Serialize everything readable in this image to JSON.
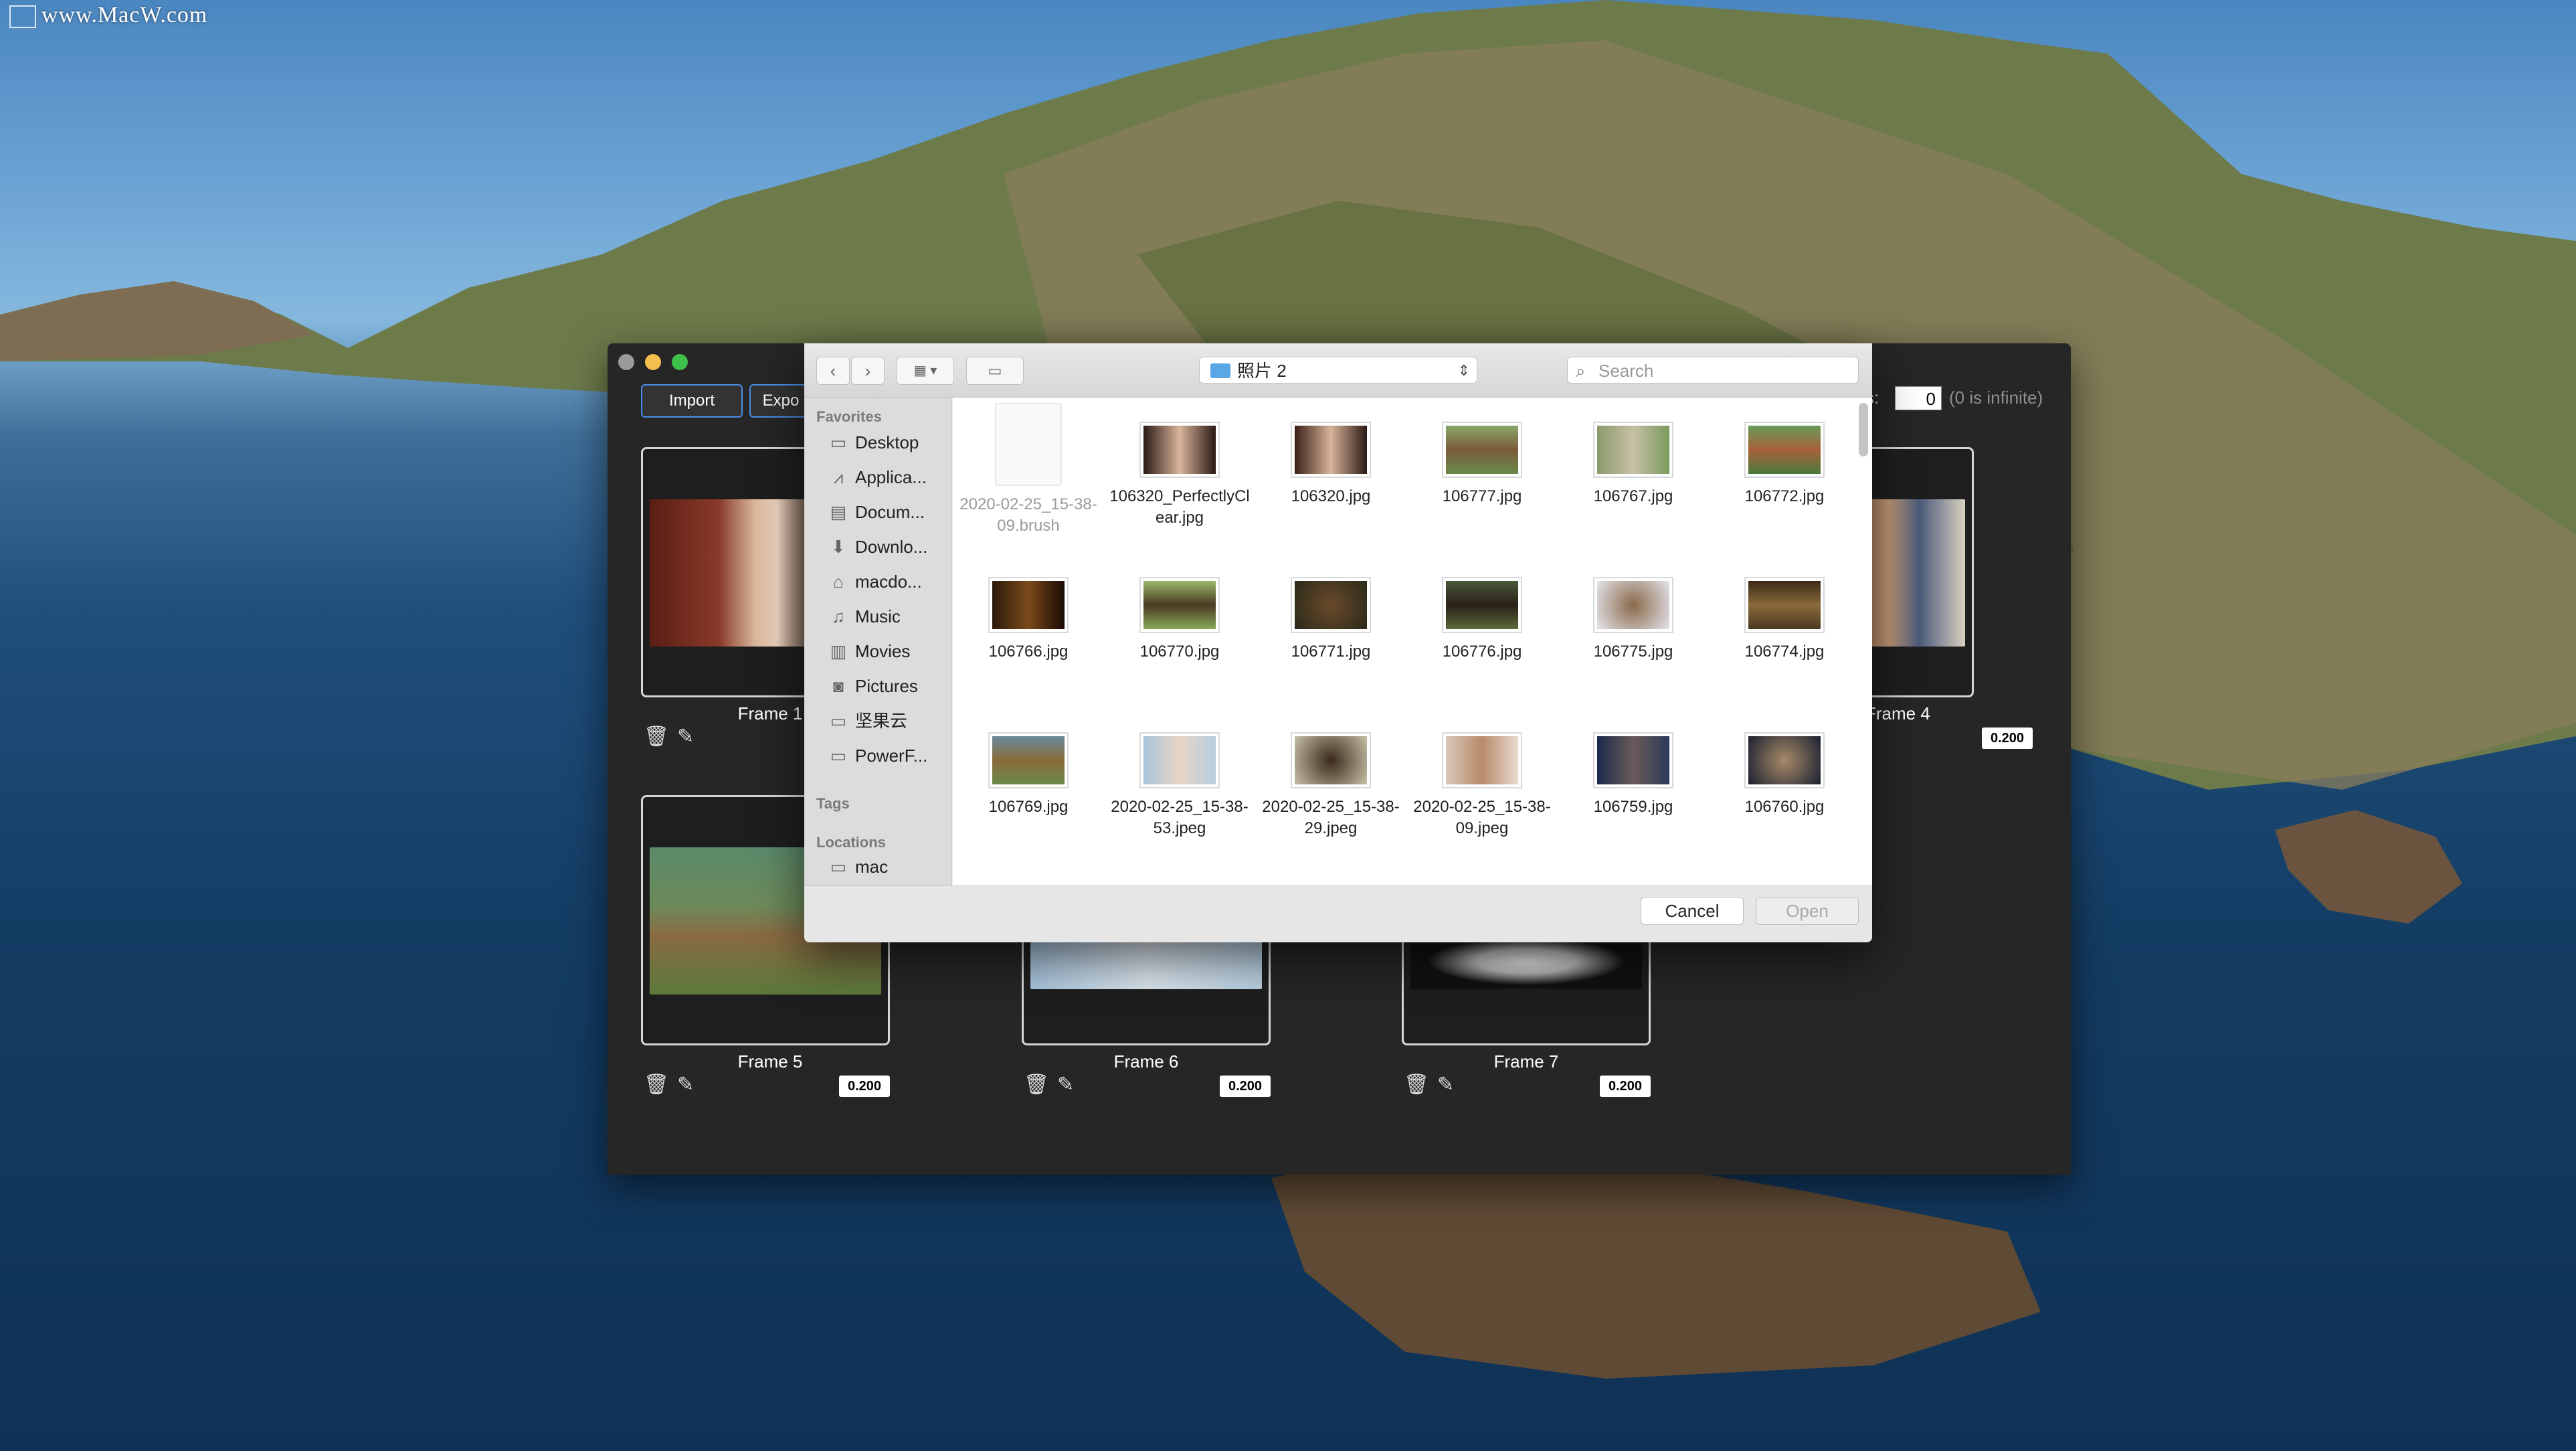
{
  "watermark": "www.MacW.com",
  "app": {
    "import_label": "Import",
    "export_label": "Expo",
    "loops_label": "s:",
    "loops_value": "0",
    "loops_hint": "(0 is infinite)",
    "frames": [
      {
        "label": "Frame 1",
        "duration": ""
      },
      {
        "label": "Frame 4",
        "duration": "0.200"
      },
      {
        "label": "Frame 5",
        "duration": "0.200"
      },
      {
        "label": "Frame 6",
        "duration": "0.200"
      },
      {
        "label": "Frame 7",
        "duration": "0.200"
      }
    ]
  },
  "dialog": {
    "folder": "照片 2",
    "search_placeholder": "Search",
    "sidebar": {
      "favorites_heading": "Favorites",
      "items": [
        "Desktop",
        "Applica...",
        "Docum...",
        "Downlo...",
        "macdo...",
        "Music",
        "Movies",
        "Pictures",
        "坚果云",
        "PowerF..."
      ],
      "tags_heading": "Tags",
      "locations_heading": "Locations",
      "locations": [
        "mac"
      ]
    },
    "files": [
      "2020-02-25_15-38-09.brush",
      "106320_PerfectlyClear.jpg",
      "106320.jpg",
      "106777.jpg",
      "106767.jpg",
      "106772.jpg",
      "106766.jpg",
      "106770.jpg",
      "106771.jpg",
      "106776.jpg",
      "106775.jpg",
      "106774.jpg",
      "106769.jpg",
      "2020-02-25_15-38-53.jpeg",
      "2020-02-25_15-38-29.jpeg",
      "2020-02-25_15-38-09.jpeg",
      "106759.jpg",
      "106760.jpg"
    ],
    "cancel_label": "Cancel",
    "open_label": "Open"
  }
}
